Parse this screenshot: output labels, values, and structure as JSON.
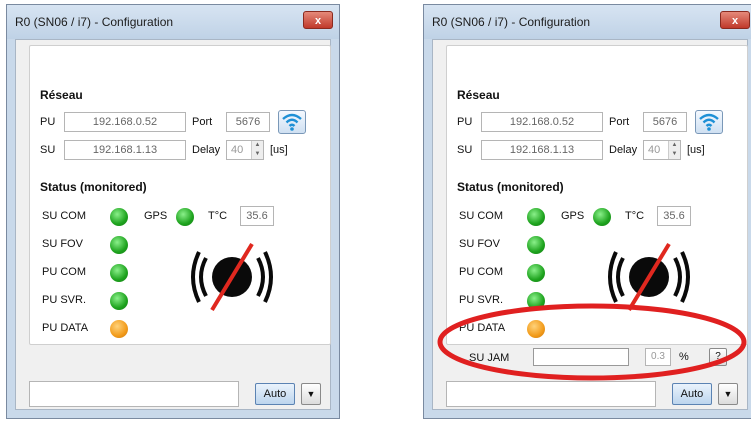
{
  "windows": [
    {
      "title": "R0 (SN06 / i7) - Configuration",
      "close_glyph": "x",
      "network": {
        "heading": "Réseau",
        "pu_label": "PU",
        "pu_ip": "192.168.0.52",
        "port_label": "Port",
        "port_value": "5676",
        "su_label": "SU",
        "su_ip": "192.168.1.13",
        "delay_label": "Delay",
        "delay_value": "40",
        "delay_unit": "[us]",
        "wifi_icon": "wifi-icon"
      },
      "status": {
        "heading": "Status (monitored)",
        "su_com": "SU COM",
        "gps": "GPS",
        "temp_label": "T°C",
        "temp_value": "35.6",
        "su_fov": "SU FOV",
        "pu_com": "PU COM",
        "pu_svr": "PU SVR.",
        "pu_data": "PU DATA",
        "colors": {
          "ok": "#1ea31e",
          "warn": "#f29b1a"
        },
        "sensor_icon": "transmitter-off-icon"
      },
      "bottom": {
        "auto_label": "Auto",
        "dropdown_glyph": "▼"
      }
    },
    {
      "title": "R0 (SN06 / i7) - Configuration",
      "network": {
        "heading": "Réseau",
        "pu_label": "PU",
        "pu_ip": "192.168.0.52",
        "port_label": "Port",
        "port_value": "5676",
        "su_label": "SU",
        "su_ip": "192.168.1.13",
        "delay_label": "Delay",
        "delay_value": "40",
        "delay_unit": "[us]"
      },
      "status": {
        "heading": "Status (monitored)",
        "su_com": "SU COM",
        "gps": "GPS",
        "temp_label": "T°C",
        "temp_value": "35.6",
        "su_fov": "SU FOV",
        "pu_com": "PU COM",
        "pu_svr": "PU SVR.",
        "pu_data": "PU DATA"
      },
      "jam": {
        "label": "SU JAM",
        "input_value": "",
        "percent_value": "0.3",
        "percent_unit": "%",
        "help_label": "?",
        "highlight_color": "#e02020"
      },
      "bottom": {
        "auto_label": "Auto",
        "dropdown_glyph": "▼"
      }
    }
  ]
}
